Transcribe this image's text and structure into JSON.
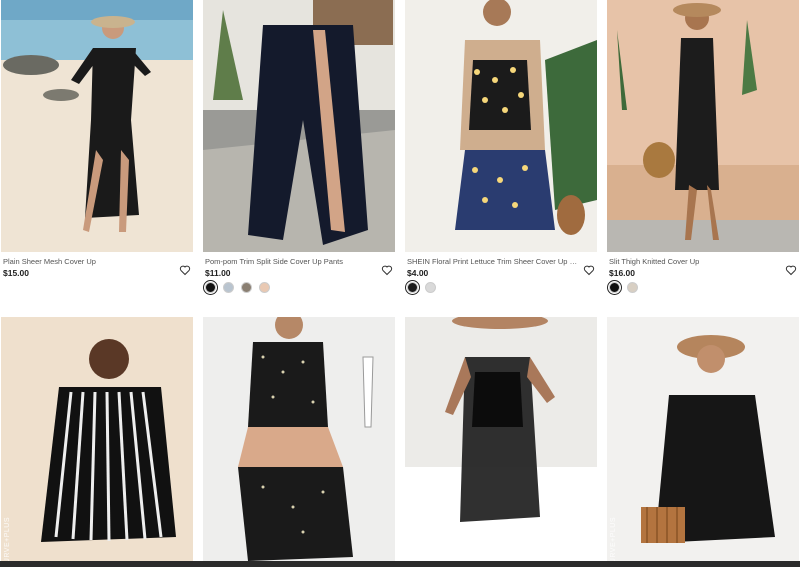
{
  "products": [
    {
      "title": "Plain Sheer Mesh Cover Up",
      "price": "$15.00",
      "swatches": []
    },
    {
      "title": "Pom-pom Trim Split Side Cover Up Pants",
      "price": "$11.00",
      "swatches": [
        "#111111",
        "#b9c4cf",
        "#8a7f72",
        "#e9c9b3"
      ]
    },
    {
      "title": "SHEIN Floral Print Lettuce Trim Sheer Cover Up Without Cami...",
      "price": "$4.00",
      "swatches": [
        "#1a1a1a",
        "#d9d9d9"
      ]
    },
    {
      "title": "Slit Thigh Knitted Cover Up",
      "price": "$16.00",
      "swatches": [
        "#111111",
        "#d8cfc3"
      ]
    }
  ],
  "row2": [
    {
      "tag": "CURVE+PLUS"
    },
    {
      "tag": ""
    },
    {
      "tag": ""
    },
    {
      "tag": "CURVE+PLUS"
    }
  ],
  "icons": {
    "wishlist": "heart-outline-icon"
  },
  "colors": {
    "price": "#222222",
    "title": "#555555",
    "selected_swatch_ring": "#222222"
  }
}
